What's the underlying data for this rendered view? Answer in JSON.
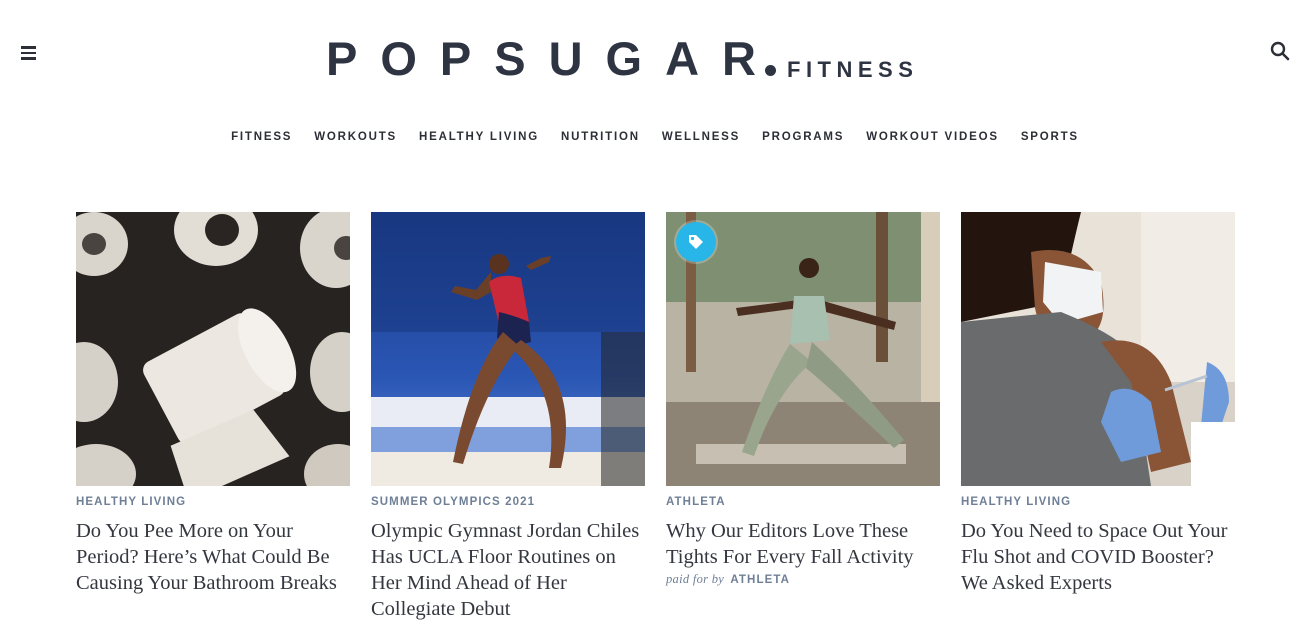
{
  "header": {
    "logo_main": "POPSUGAR",
    "logo_sub": "FITNESS",
    "menu_icon": "hamburger-menu-icon",
    "search_icon": "search-icon"
  },
  "nav": {
    "items": [
      "FITNESS",
      "WORKOUTS",
      "HEALTHY LIVING",
      "NUTRITION",
      "WELLNESS",
      "PROGRAMS",
      "WORKOUT VIDEOS",
      "SPORTS"
    ]
  },
  "cards": [
    {
      "category": "HEALTHY LIVING",
      "headline": "Do You Pee More on Your Period? Here’s What Could Be Causing Your Bathroom Breaks",
      "image": "toilet-paper-rolls"
    },
    {
      "category": "SUMMER OLYMPICS 2021",
      "headline": "Olympic Gymnast Jordan Chiles Has UCLA Floor Routines on Her Mind Ahead of Her Collegiate Debut",
      "image": "gymnast-floor-routine"
    },
    {
      "category": "ATHLETA",
      "headline": "Why Our Editors Love These Tights For Every Fall Activity",
      "image": "yoga-warrior-pose",
      "badge_icon": "tag-icon",
      "sponsor_prefix": "paid for by",
      "sponsor_brand": "ATHLETA"
    },
    {
      "category": "HEALTHY LIVING",
      "headline": "Do You Need to Space Out Your Flu Shot and COVID Booster? We Asked Experts",
      "image": "vaccine-injection"
    }
  ],
  "colors": {
    "text_dark": "#2c2f36",
    "category": "#6e7f96",
    "badge": "#28b5e8"
  }
}
